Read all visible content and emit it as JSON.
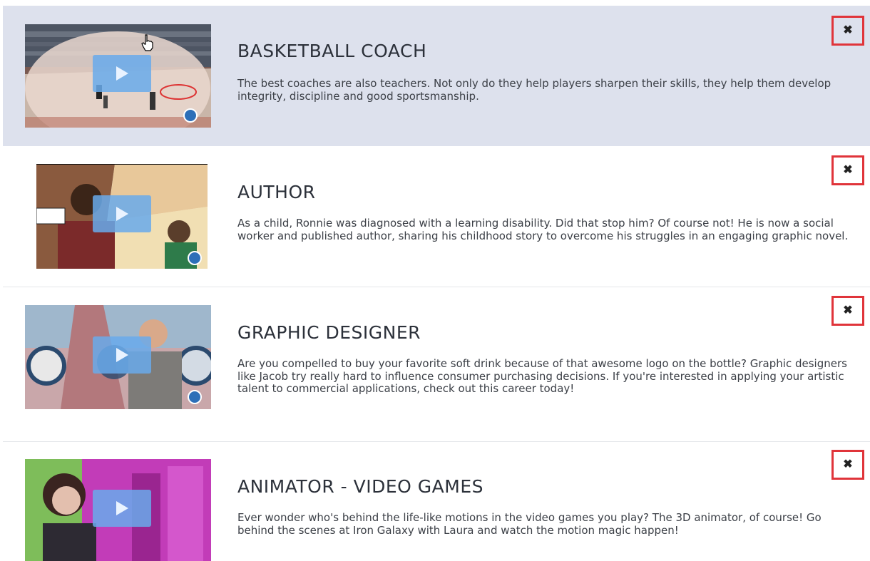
{
  "careers": [
    {
      "title": "BASKETBALL COACH",
      "description": "The best coaches are also teachers. Not only do they help players sharpen their skills, they help them develop integrity, discipline and good sportsmanship.",
      "close_label": "✖",
      "thumbnail": "basketball-court-video"
    },
    {
      "title": "AUTHOR",
      "description": "As a child, Ronnie was diagnosed with a learning disability. Did that stop him? Of course not! He is now a social worker and published author, sharing his childhood story to overcome his struggles in an engaging graphic novel.",
      "close_label": "✖",
      "thumbnail": "author-comic-video"
    },
    {
      "title": "GRAPHIC DESIGNER",
      "description": "Are you compelled to buy your favorite soft drink because of that awesome logo on the bottle? Graphic designers like Jacob try really hard to influence consumer purchasing decisions. If you're interested in applying your artistic talent to commercial applications, check out this career today!",
      "close_label": "✖",
      "thumbnail": "graphic-designer-video"
    },
    {
      "title": "ANIMATOR - VIDEO GAMES",
      "description": "Ever wonder who's behind the life-like motions in the video games you play? The 3D animator, of course! Go behind the scenes at Iron Galaxy with Laura and watch the motion magic happen!",
      "close_label": "✖",
      "thumbnail": "animator-video"
    }
  ],
  "colors": {
    "highlight_row": "#dde1ed",
    "close_outline": "#e0343a",
    "play_button": "#69aaeb"
  }
}
